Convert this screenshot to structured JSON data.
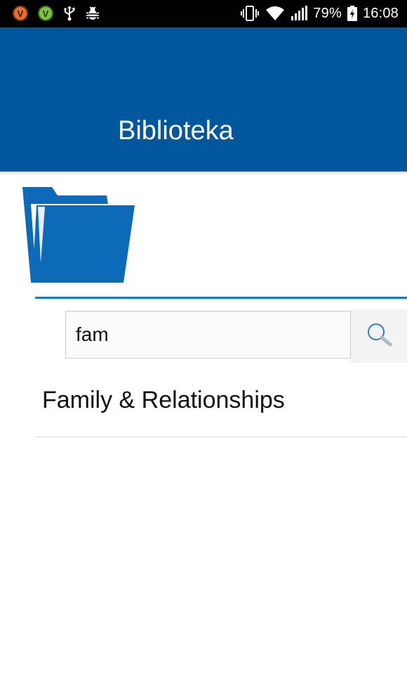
{
  "status_bar": {
    "app_badges": [
      "V",
      "V"
    ],
    "icons": [
      "usb-icon",
      "bug-icon",
      "vibrate-icon",
      "wifi-icon",
      "signal-icon",
      "battery-charging-icon"
    ],
    "battery_percent": "79%",
    "time": "16:08"
  },
  "app_bar": {
    "title": "Biblioteka",
    "color": "#01579b"
  },
  "header": {
    "icon": "folder-icon",
    "folder_color": "#0d6ab8",
    "divider_color": "#1976d2"
  },
  "search": {
    "value": "fam",
    "icon": "search-icon"
  },
  "results": [
    {
      "label": "Family & Relationships"
    }
  ]
}
